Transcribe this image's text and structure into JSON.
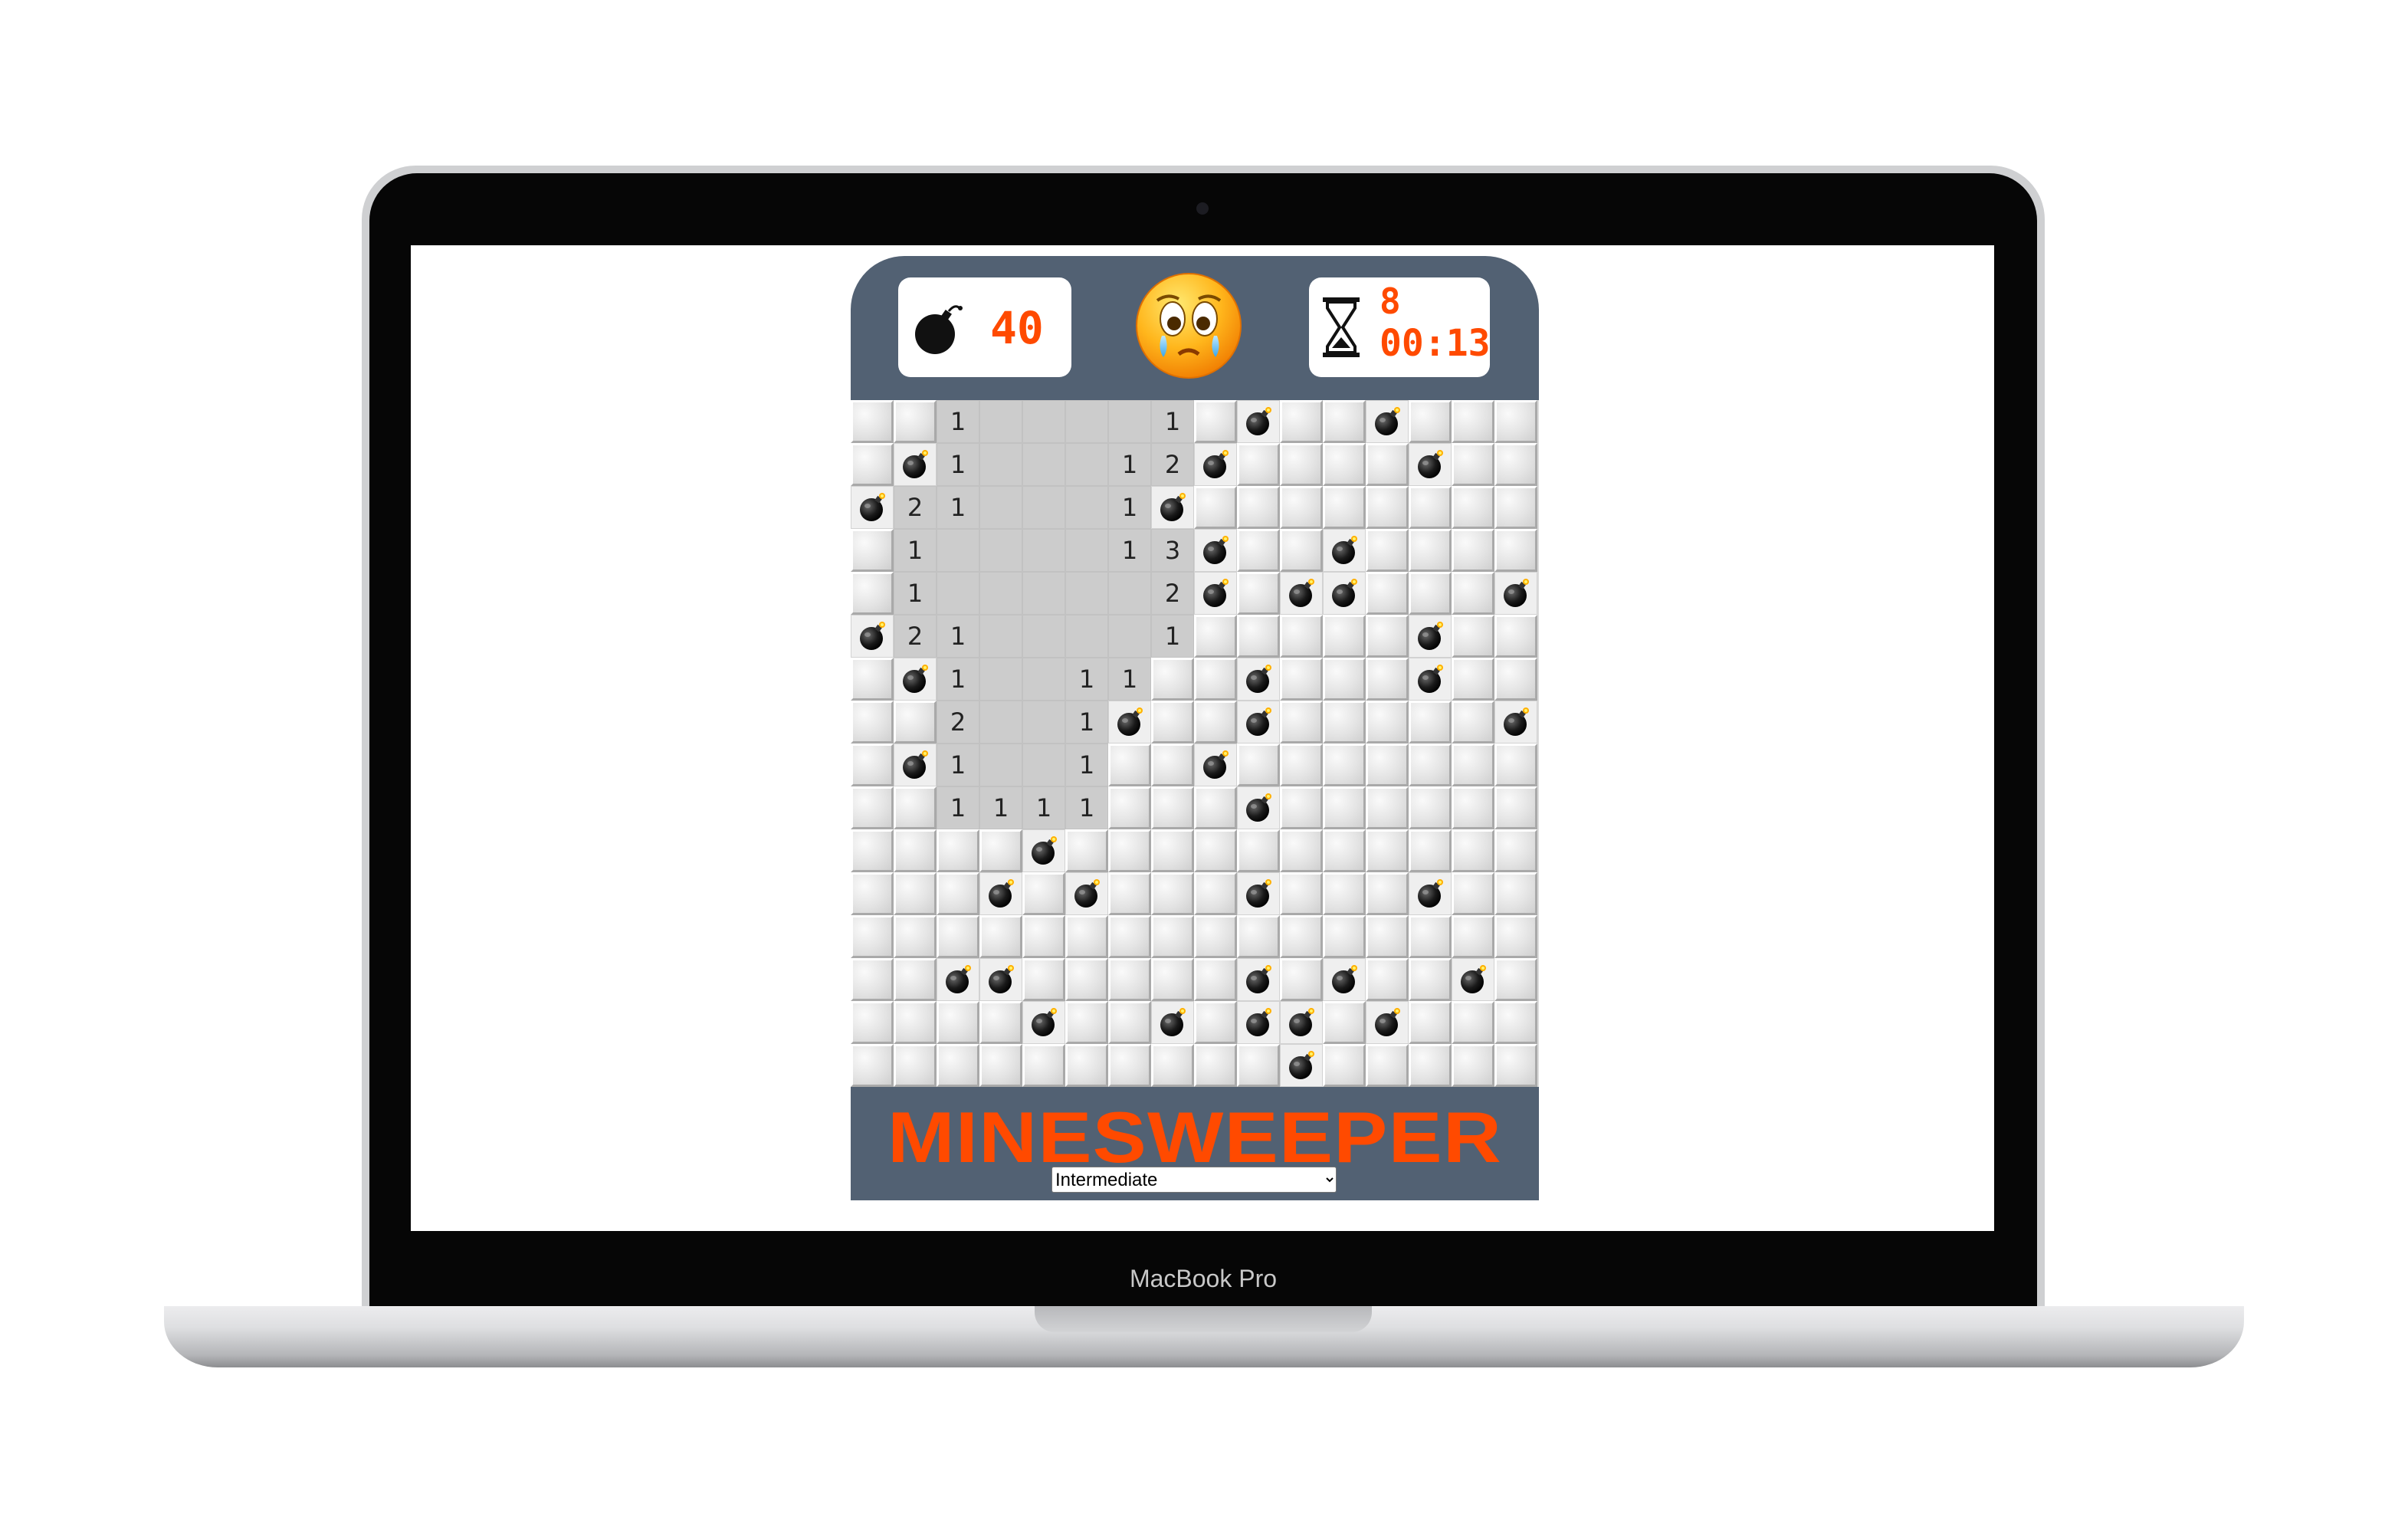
{
  "device": {
    "label": "MacBook Pro"
  },
  "game": {
    "mines_remaining": "40",
    "level_number": "8",
    "timer": "00:13",
    "status_face": "crying-face",
    "title": "MINESWEEPER",
    "difficulty": {
      "selected": "Intermediate",
      "options": [
        "Intermediate"
      ]
    }
  },
  "colors": {
    "panel": "#526173",
    "accent": "#ff4a00",
    "revealed_cell": "#cccccc"
  },
  "board": {
    "cols": 16,
    "rows": 16,
    "legend": {
      "#": "hidden",
      ".": "revealed-empty",
      "*": "mine",
      "1-8": "revealed-number"
    },
    "grid": [
      "##1....1#*##*###",
      "#*1...12*####*##",
      "*21...1*########",
      "#1....13*##*####",
      "#1.....2*#**###*",
      "*21....1#####*##",
      "#*1..11##*###*##",
      "##2..1*##*#####*",
      "#*1..1##*#######",
      "##1111###*######",
      "####*###########",
      "###*#*###*###*##",
      "################",
      "##**#####*#*##*#",
      "####*##*#**#*###",
      "##########*#####"
    ]
  }
}
